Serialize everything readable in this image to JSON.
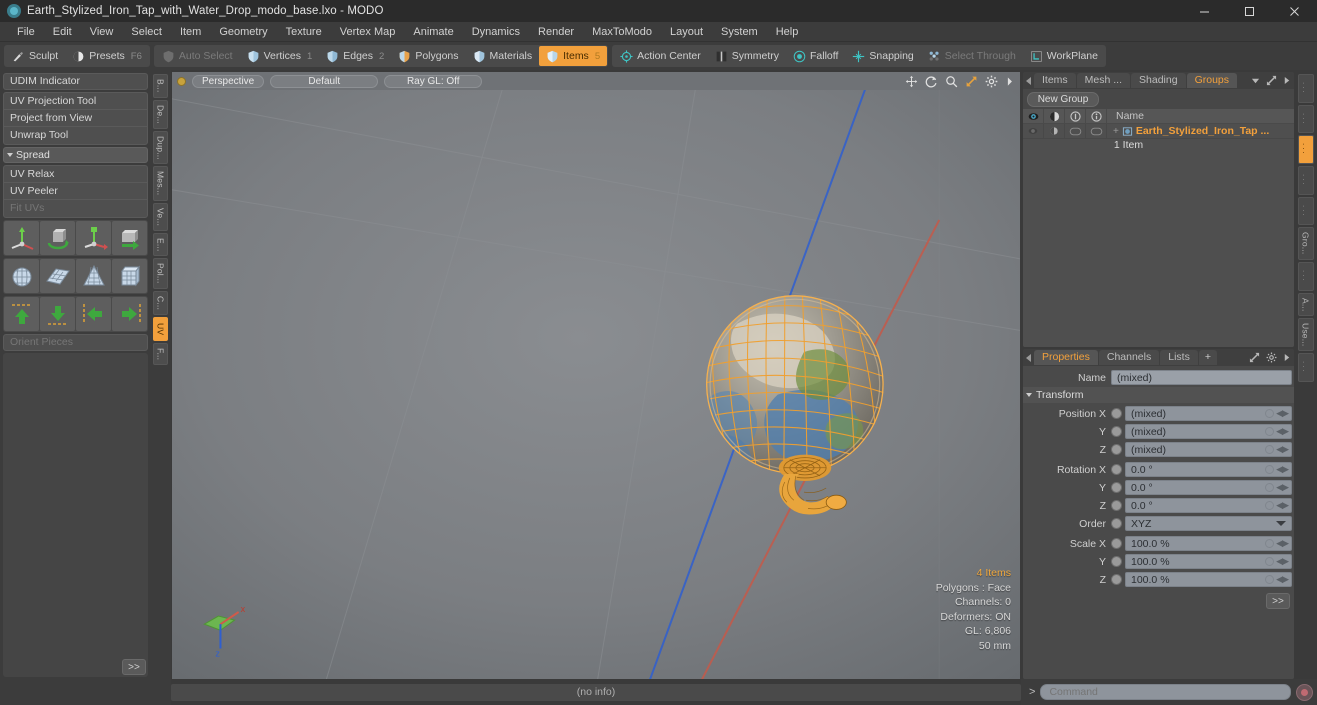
{
  "window": {
    "title": "Earth_Stylized_Iron_Tap_with_Water_Drop_modo_base.lxo - MODO",
    "app_icon": "modo-logo-icon",
    "minimize": "minimize-icon",
    "maximize": "maximize-icon",
    "close": "close-icon"
  },
  "menubar": {
    "items": [
      "File",
      "Edit",
      "View",
      "Select",
      "Item",
      "Geometry",
      "Texture",
      "Vertex Map",
      "Animate",
      "Dynamics",
      "Render",
      "MaxToModo",
      "Layout",
      "System",
      "Help"
    ]
  },
  "modebar": {
    "group1": [
      {
        "label": "Sculpt",
        "icon": "sculpt-brush-icon",
        "num": "",
        "state": "normal"
      },
      {
        "label": "Presets",
        "icon": "presets-sphere-icon",
        "num": "F6",
        "state": "normal"
      }
    ],
    "group2": [
      {
        "label": "Auto Select",
        "icon": "shield-gray-icon",
        "num": "",
        "state": "dim"
      },
      {
        "label": "Vertices",
        "icon": "shield-vertices-icon",
        "num": "1",
        "state": "normal"
      },
      {
        "label": "Edges",
        "icon": "shield-edges-icon",
        "num": "2",
        "state": "normal"
      },
      {
        "label": "Polygons",
        "icon": "shield-polygons-icon",
        "num": "",
        "state": "normal"
      },
      {
        "label": "Materials",
        "icon": "shield-materials-icon",
        "num": "",
        "state": "normal"
      },
      {
        "label": "Items",
        "icon": "shield-items-icon",
        "num": "5",
        "state": "active"
      }
    ],
    "group3": [
      {
        "label": "Action Center",
        "icon": "action-center-icon",
        "num": "",
        "state": "normal"
      },
      {
        "label": "Symmetry",
        "icon": "symmetry-icon",
        "num": "",
        "state": "normal"
      },
      {
        "label": "Falloff",
        "icon": "falloff-icon",
        "num": "",
        "state": "normal"
      },
      {
        "label": "Snapping",
        "icon": "snapping-icon",
        "num": "",
        "state": "normal"
      },
      {
        "label": "Select Through",
        "icon": "select-through-icon",
        "num": "",
        "state": "dim"
      },
      {
        "label": "WorkPlane",
        "icon": "workplane-icon",
        "num": "",
        "state": "normal"
      }
    ]
  },
  "left_panel": {
    "udim": "UDIM Indicator",
    "tools_group_1": [
      "UV Projection Tool",
      "Project from View",
      "Unwrap Tool"
    ],
    "spread_header": "Spread",
    "tools_group_2": [
      "UV Relax",
      "UV Peeler",
      "Fit UVs"
    ],
    "orient_pieces": "Orient Pieces",
    "go_button": ">>",
    "icon_rows": [
      [
        "uv-move-axis-icon",
        "uv-rotate-cube-icon",
        "uv-scale-axis-icon",
        "uv-flip-cube-icon"
      ],
      [
        "uv-sphere-map-icon",
        "uv-plane-map-icon",
        "uv-cone-map-icon",
        "uv-box-map-icon"
      ],
      [
        "uv-align-up-icon",
        "uv-align-down-icon",
        "uv-align-left-icon",
        "uv-align-right-icon"
      ]
    ],
    "vtabs": [
      {
        "label": "B...",
        "active": false
      },
      {
        "label": "De...",
        "active": false
      },
      {
        "label": "Dup...",
        "active": false
      },
      {
        "label": "Mes...",
        "active": false
      },
      {
        "label": "Ve...",
        "active": false
      },
      {
        "label": "E...",
        "active": false
      },
      {
        "label": "Pol...",
        "active": false
      },
      {
        "label": "C...",
        "active": false
      },
      {
        "label": "UV",
        "active": true
      },
      {
        "label": "F...",
        "active": false
      }
    ]
  },
  "viewport": {
    "header": {
      "dot": "viewport-active-dot-icon",
      "buttons": [
        "Perspective",
        "Default",
        "Ray GL: Off"
      ],
      "tools": [
        "pan-icon",
        "rotate-icon",
        "zoom-icon",
        "fit-view-icon",
        "viewport-settings-icon",
        "viewport-more-icon"
      ]
    },
    "info": {
      "items_count": "4 Items",
      "polygons": "Polygons : Face",
      "channels": "Channels: 0",
      "deformers": "Deformers: ON",
      "gl": "GL: 6,806",
      "scale": "50 mm"
    },
    "axis_gizmo": "axis-gizmo-icon",
    "status": "(no info)",
    "model": "earth-globe-with-iron-tap-wireframe"
  },
  "right_panel": {
    "top_tabs": [
      {
        "label": "Items",
        "active": false
      },
      {
        "label": "Mesh ...",
        "active": false
      },
      {
        "label": "Shading",
        "active": false
      },
      {
        "label": "Groups",
        "active": true
      }
    ],
    "top_tab_icons": [
      "tab-dropdown-icon",
      "panel-expand-icon",
      "panel-more-icon"
    ],
    "new_group_button": "New Group",
    "list_header": {
      "col_icons": [
        "eye-icon",
        "render-icon",
        "lock-icon",
        "info-icon"
      ],
      "name": "Name"
    },
    "rows": [
      {
        "name": "Earth_Stylized_Iron_Tap ...",
        "icon": "group-item-icon",
        "expander": "+",
        "sub": "1 Item"
      }
    ],
    "bottom_tabs": [
      {
        "label": "Properties",
        "active": true
      },
      {
        "label": "Channels",
        "active": false
      },
      {
        "label": "Lists",
        "active": false
      },
      {
        "label": "+",
        "active": false
      }
    ],
    "bottom_tab_icons": [
      "panel-expand-icon",
      "panel-settings-icon",
      "panel-more-icon"
    ],
    "properties": {
      "name_label": "Name",
      "name_value": "(mixed)",
      "section": "Transform",
      "fields": [
        {
          "label": "Position X",
          "value": "(mixed)",
          "type": "num"
        },
        {
          "label": "Y",
          "value": "(mixed)",
          "type": "num"
        },
        {
          "label": "Z",
          "value": "(mixed)",
          "type": "num"
        },
        {
          "label": "Rotation X",
          "value": "0.0 °",
          "type": "num"
        },
        {
          "label": "Y",
          "value": "0.0 °",
          "type": "num"
        },
        {
          "label": "Z",
          "value": "0.0 °",
          "type": "num"
        },
        {
          "label": "Order",
          "value": "XYZ",
          "type": "dropdown"
        },
        {
          "label": "Scale X",
          "value": "100.0 %",
          "type": "num"
        },
        {
          "label": "Y",
          "value": "100.0 %",
          "type": "num"
        },
        {
          "label": "Z",
          "value": "100.0 %",
          "type": "num"
        }
      ],
      "more_button": ">>"
    },
    "vtabs": [
      {
        "label": "...",
        "active": false
      },
      {
        "label": "...",
        "active": false
      },
      {
        "label": "...",
        "active": true
      },
      {
        "label": "...",
        "active": false
      },
      {
        "label": "...",
        "active": false
      },
      {
        "label": "Gro...",
        "active": false
      },
      {
        "label": "...",
        "active": false
      },
      {
        "label": "A...",
        "active": false
      },
      {
        "label": "Use...",
        "active": false
      },
      {
        "label": "...",
        "active": false
      }
    ]
  },
  "command_bar": {
    "prompt": ">",
    "placeholder": "Command",
    "record_button": "record-command-icon"
  },
  "colors": {
    "accent": "#f2a03c",
    "panel": "#3c3c3c",
    "field": "#8e949c",
    "viewport_bg": "#7a7d81"
  }
}
